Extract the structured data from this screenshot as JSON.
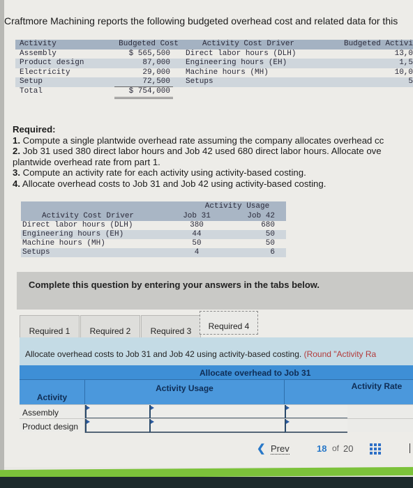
{
  "intro": "Craftmore Machining reports the following budgeted overhead cost and related data for this",
  "overhead_table": {
    "headers": {
      "activity": "Activity",
      "budgeted_cost": "Budgeted Cost",
      "cost_driver": "Activity Cost Driver",
      "budgeted_activity": "Budgeted Activi"
    },
    "rows": [
      {
        "activity": "Assembly",
        "cost": "$ 565,500",
        "driver": "Direct labor hours (DLH)",
        "budgeted": "13,0"
      },
      {
        "activity": "Product design",
        "cost": "87,000",
        "driver": "Engineering hours (EH)",
        "budgeted": "1,5"
      },
      {
        "activity": "Electricity",
        "cost": "29,000",
        "driver": "Machine hours (MH)",
        "budgeted": "10,0"
      },
      {
        "activity": "Setup",
        "cost": "72,500",
        "driver": "Setups",
        "budgeted": "5"
      }
    ],
    "total": {
      "label": "Total",
      "cost": "$ 754,000"
    }
  },
  "required": {
    "heading": "Required:",
    "items": [
      {
        "num": "1.",
        "text": " Compute a single plantwide overhead rate assuming the company allocates overhead cc"
      },
      {
        "num": "2.",
        "text": " Job 31 used 380 direct labor hours and Job 42 used 680 direct labor hours. Allocate ove"
      },
      {
        "num": "",
        "text": "plantwide overhead rate from part 1."
      },
      {
        "num": "3.",
        "text": " Compute an activity rate for each activity using activity-based costing."
      },
      {
        "num": "4.",
        "text": " Allocate overhead costs to Job 31 and Job 42 using activity-based costing."
      }
    ]
  },
  "usage_table": {
    "group_header": "Activity Usage",
    "headers": {
      "driver": "Activity Cost Driver",
      "job31": "Job 31",
      "job42": "Job 42"
    },
    "rows": [
      {
        "driver": "Direct labor hours (DLH)",
        "job31": "380",
        "job42": "680"
      },
      {
        "driver": "Engineering hours (EH)",
        "job31": "44",
        "job42": "50"
      },
      {
        "driver": "Machine hours (MH)",
        "job31": "50",
        "job42": "50"
      },
      {
        "driver": "Setups",
        "job31": "4",
        "job42": "6"
      }
    ]
  },
  "complete_instruction": "Complete this question by entering your answers in the tabs below.",
  "tabs": [
    {
      "label": "Required 1",
      "active": false
    },
    {
      "label": "Required 2",
      "active": false
    },
    {
      "label": "Required 3",
      "active": false
    },
    {
      "label": "Required 4",
      "active": true
    }
  ],
  "panel": {
    "instruction": "Allocate overhead costs to Job 31 and Job 42 using activity-based costing. ",
    "note": "(Round \"Activity Ra"
  },
  "abc_table": {
    "title": "Allocate overhead to Job 31",
    "headers": {
      "activity": "Activity",
      "usage": "Activity Usage",
      "rate": "Activity Rate"
    },
    "rows": [
      {
        "activity": "Assembly",
        "usage_qty": "",
        "usage_unit": "",
        "rate": ""
      },
      {
        "activity": "Product design",
        "usage_qty": "",
        "usage_unit": "",
        "rate": ""
      }
    ]
  },
  "navigation": {
    "prev_label": "Prev",
    "current": "18",
    "of": "of",
    "total": "20"
  }
}
